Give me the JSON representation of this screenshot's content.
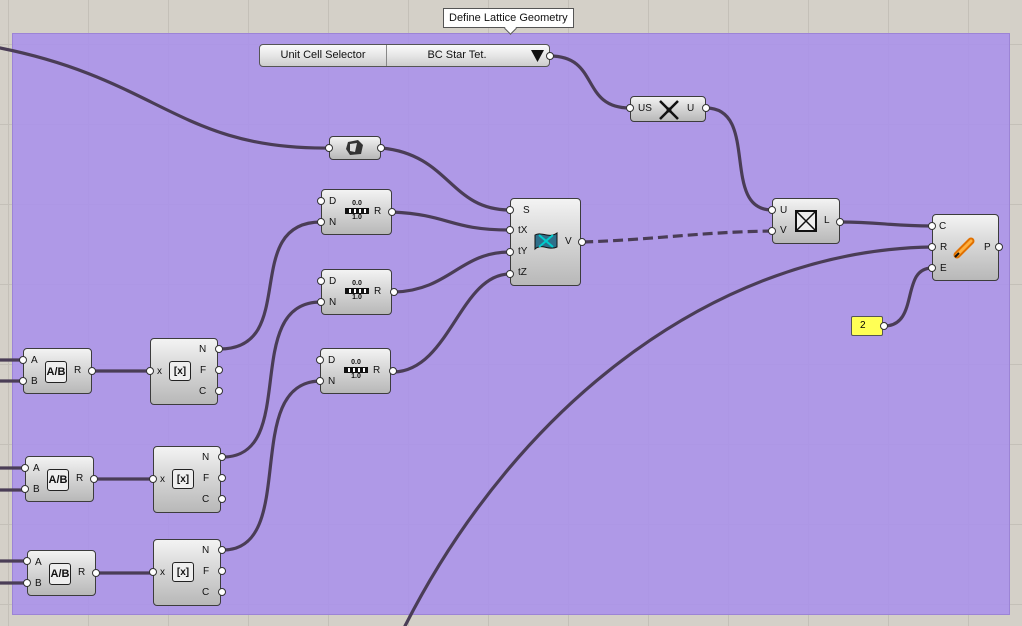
{
  "group": {
    "title": "Define Lattice Geometry",
    "color": "#ab91eb"
  },
  "selector": {
    "label": "Unit Cell Selector",
    "value": "BC Star Tet."
  },
  "panel": {
    "value": "2"
  },
  "pins": {
    "a": "A",
    "b": "B",
    "r": "R",
    "n": "N",
    "f": "F",
    "c": "C",
    "x": "x",
    "d": "D",
    "s": "S",
    "tx": "tX",
    "ty": "tY",
    "tz": "tZ",
    "v": "V",
    "u": "U",
    "us": "US",
    "l": "L",
    "e": "E",
    "p": "P"
  },
  "range_icon": {
    "top": "0.0",
    "bottom": "1.0"
  }
}
